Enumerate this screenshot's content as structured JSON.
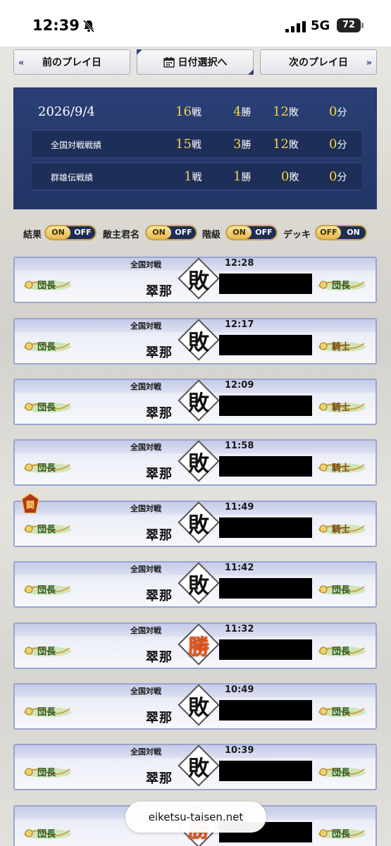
{
  "status": {
    "time": "12:39",
    "network": "5G",
    "battery": "72"
  },
  "nav": {
    "prev": "前のプレイ日",
    "date": "日付選択へ",
    "next": "次のプレイ日"
  },
  "summary": {
    "date": "2026/9/4",
    "total": {
      "battles": "16",
      "wins": "4",
      "losses": "12",
      "draws": "0"
    },
    "rows": [
      {
        "label": "全国対戦戦績",
        "battles": "15",
        "wins": "3",
        "losses": "12",
        "draws": "0"
      },
      {
        "label": "群雄伝戦績",
        "battles": "1",
        "wins": "1",
        "losses": "0",
        "draws": "0"
      }
    ],
    "units": {
      "battles": "戦",
      "wins": "勝",
      "losses": "敗",
      "draws": "分"
    }
  },
  "toggles": [
    {
      "label": "結果",
      "on": "ON",
      "off": "OFF"
    },
    {
      "label": "敵主君名",
      "on": "ON",
      "off": "OFF"
    },
    {
      "label": "階級",
      "on": "ON",
      "off": "OFF"
    },
    {
      "label": "デッキ",
      "on": "ON",
      "off": "OFF"
    }
  ],
  "records": [
    {
      "mode": "全国対戦",
      "time": "12:28",
      "player": "翠那",
      "result": "敗",
      "left_rank": "団長",
      "right_rank": "団長"
    },
    {
      "mode": "全国対戦",
      "time": "12:17",
      "player": "翠那",
      "result": "敗",
      "left_rank": "団長",
      "right_rank": "騎士"
    },
    {
      "mode": "全国対戦",
      "time": "12:09",
      "player": "翠那",
      "result": "敗",
      "left_rank": "団長",
      "right_rank": "騎士"
    },
    {
      "mode": "全国対戦",
      "time": "11:58",
      "player": "翠那",
      "result": "敗",
      "left_rank": "団長",
      "right_rank": "騎士"
    },
    {
      "mode": "全国対戦",
      "time": "11:49",
      "player": "翠那",
      "result": "敗",
      "left_rank": "団長",
      "right_rank": "騎士",
      "badge": "闘"
    },
    {
      "mode": "全国対戦",
      "time": "11:42",
      "player": "翠那",
      "result": "敗",
      "left_rank": "団長",
      "right_rank": "団長"
    },
    {
      "mode": "全国対戦",
      "time": "11:32",
      "player": "翠那",
      "result": "勝",
      "left_rank": "団長",
      "right_rank": "団長"
    },
    {
      "mode": "全国対戦",
      "time": "10:49",
      "player": "翠那",
      "result": "敗",
      "left_rank": "団長",
      "right_rank": "団長"
    },
    {
      "mode": "全国対戦",
      "time": "10:39",
      "player": "翠那",
      "result": "敗",
      "left_rank": "団長",
      "right_rank": "団長"
    },
    {
      "mode": "",
      "time": "",
      "player": "",
      "result": "勝",
      "left_rank": "団長",
      "right_rank": "団長"
    }
  ],
  "url": "eiketsu-taisen.net",
  "colors": {
    "accent": "#2b4386",
    "gold": "#f5d24a",
    "panel": "#223565"
  },
  "icons": {
    "bell": "bell-slash-icon",
    "calendar": "calendar-icon",
    "prev": "double-chevron-left-icon",
    "next": "double-chevron-right-icon"
  }
}
